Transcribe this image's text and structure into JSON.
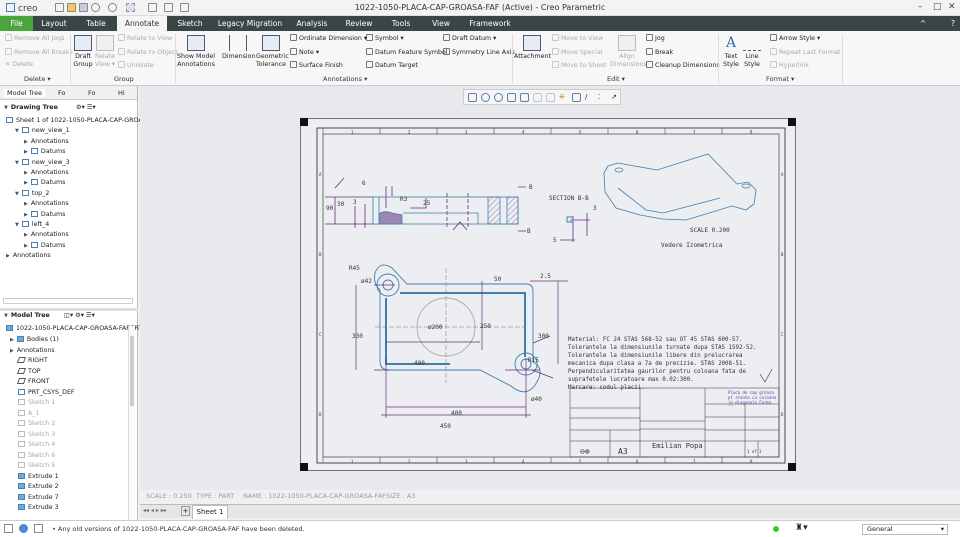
{
  "app": {
    "logo": "creo",
    "title": "1022-1050-PLACA-CAP-GROASA-FAF (Active) - Creo Parametric"
  },
  "tabs": [
    "File",
    "Layout",
    "Table",
    "Annotate",
    "Sketch",
    "Legacy Migration",
    "Analysis",
    "Review",
    "Tools",
    "View",
    "Framework"
  ],
  "ribbon": {
    "delete": {
      "items": [
        "Remove All Jogs",
        "Remove All Breaks",
        "Delete"
      ],
      "label": "Delete ▾"
    },
    "group": {
      "draft_group": "Draft Group",
      "relate_view": "Relate View ▾",
      "items": [
        "Relate to View",
        "Relate to Object",
        "Unrelate"
      ],
      "label": "Group"
    },
    "annotations": {
      "show_model": "Show Model Annotations",
      "dimension": "Dimension",
      "geom_tol": "Geometric Tolerance",
      "col1": [
        "Ordinate Dimension ▾",
        "Note ▾",
        "Surface Finish"
      ],
      "col2": [
        "Symbol ▾",
        "Datum Feature Symbol",
        "Datum Target"
      ],
      "col3": [
        "Draft Datum ▾",
        "Symmetry Line Axis"
      ],
      "label": "Annotations ▾"
    },
    "edit": {
      "attachment": "Attachment",
      "move": [
        "Move to View",
        "Move Special",
        "Move to Sheet"
      ],
      "align": "Align Dimensions",
      "col": [
        "Jog",
        "Break",
        "Cleanup Dimensions"
      ],
      "label": "Edit ▾"
    },
    "format": {
      "text_style": "Text Style",
      "line_style": "Line Style",
      "items": [
        "Arrow Style ▾",
        "Repeat Last Format",
        "Hyperlink"
      ],
      "label": "Format ▾"
    }
  },
  "panel": {
    "tabs": [
      "Model Tree",
      "Fo",
      "Fo",
      "Hi"
    ],
    "drawing_tree": {
      "title": "Drawing Tree",
      "items": [
        "Sheet 1 of 1022-1050-PLACA-CAP-GROASA-",
        "new_view_1",
        "Annotations",
        "Datums",
        "new_view_3",
        "Annotations",
        "Datums",
        "top_2",
        "Annotations",
        "Datums",
        "left_4",
        "Annotations",
        "Datums",
        "Annotations"
      ]
    },
    "model_tree": {
      "title": "Model Tree",
      "root": "1022-1050-PLACA-CAP-GROASA-FAF.PRT",
      "items": [
        "Bodies (1)",
        "Annotations",
        "RIGHT",
        "TOP",
        "FRONT",
        "PRT_CSYS_DEF",
        "Sketch 1",
        "A_1",
        "Sketch 2",
        "Sketch 3",
        "Sketch 4",
        "Sketch 6",
        "Sketch 5",
        "Extrude 1",
        "Extrude 2",
        "Extrude 7",
        "Extrude 3"
      ]
    }
  },
  "drawing": {
    "border_cols": [
      "1",
      "2",
      "3",
      "4",
      "5",
      "6",
      "7",
      "8"
    ],
    "border_rows": [
      "A",
      "B",
      "C",
      "D"
    ],
    "dims_top": [
      "6",
      "R3",
      "25",
      "30",
      "3",
      "90",
      "B",
      "B"
    ],
    "section": {
      "title": "SECTION B-B",
      "d1": "3",
      "d2": "5"
    },
    "dims_plan": [
      "R45",
      "ø42",
      "50",
      "2.5",
      "ø200",
      "250",
      "330",
      "300",
      "400",
      "R15",
      "ø40",
      "400",
      "450"
    ],
    "iso": {
      "scale": "SCALE 0.200",
      "caption": "Vedere Izometrica"
    },
    "notes": [
      "Material: FC 24 STAS 568-52 sau OT 45 STAS 600-57.",
      "Tolerantele la dimensiunile turnate dupa STAS 1592-52.",
      "Tolerantele la dimensiunile libere din prelucrarea",
      "mecanica dupa clasa a 7a de precizie. STAS 2008-51.",
      "Perpendicularitatea gaurilor pentru coloana fata de",
      "suprafetele lucratoare max 0.02:300.",
      "Marcare: codul placii."
    ],
    "titleblock": {
      "description": "Placa de cap groasa pt stanta cu coloane in diagonala Forma AF",
      "author": "Emilian Popa",
      "size": "A3",
      "sheet": "1 of 1"
    }
  },
  "status": {
    "scale": "SCALE : 0.250",
    "type": "TYPE : PART",
    "name": "NAME : 1022-1050-PLACA-CAP-GROASA-FAF",
    "size": "SIZE : A3",
    "sheet_tab": "Sheet 1",
    "message": "• Any old versions of 1022-1050-PLACA-CAP-GROASA-FAF have been deleted.",
    "filter": "General"
  },
  "colors": {
    "file_tab": "#4aa63c",
    "tabbar": "#3a4646",
    "geom": "#3f7fb0",
    "dim": "#6a2f7a"
  }
}
